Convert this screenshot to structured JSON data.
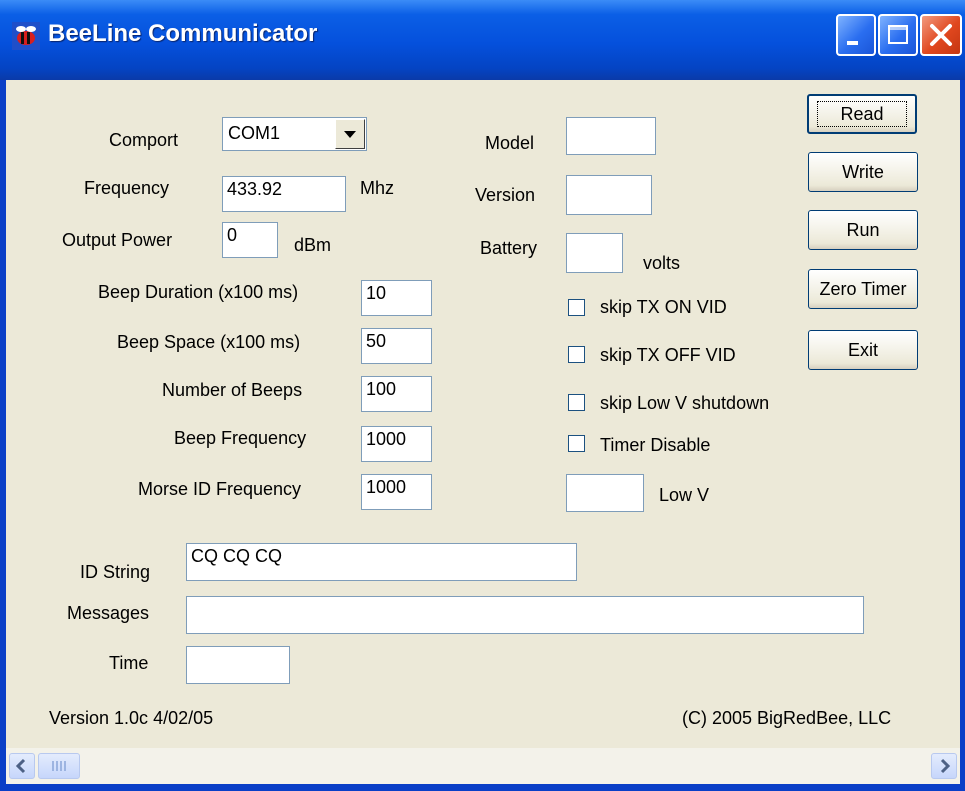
{
  "window": {
    "title": "BeeLine Communicator"
  },
  "left": {
    "comport_label": "Comport",
    "comport_value": "COM1",
    "frequency_label": "Frequency",
    "frequency_value": "433.92",
    "frequency_unit": "Mhz",
    "power_label": "Output Power",
    "power_value": "0",
    "power_unit": "dBm",
    "beep_duration_label": "Beep Duration (x100 ms)",
    "beep_duration_value": "10",
    "beep_space_label": "Beep Space (x100 ms)",
    "beep_space_value": "50",
    "num_beeps_label": "Number of Beeps",
    "num_beeps_value": "100",
    "beep_freq_label": "Beep Frequency",
    "beep_freq_value": "1000",
    "morse_freq_label": "Morse ID Frequency",
    "morse_freq_value": "1000"
  },
  "right": {
    "model_label": "Model",
    "model_value": "",
    "version_label": "Version",
    "version_value": "",
    "battery_label": "Battery",
    "battery_value": "",
    "battery_unit": "volts",
    "checkboxes": [
      {
        "label": "skip TX ON VID",
        "checked": false
      },
      {
        "label": "skip TX OFF VID",
        "checked": false
      },
      {
        "label": "skip Low V shutdown",
        "checked": false
      },
      {
        "label": "Timer Disable",
        "checked": false
      }
    ],
    "lowv_value": "",
    "lowv_label": "Low V"
  },
  "buttons": {
    "read": "Read",
    "write": "Write",
    "run": "Run",
    "zero_timer": "Zero Timer",
    "exit": "Exit"
  },
  "bottom": {
    "id_string_label": "ID String",
    "id_string_value": "CQ CQ CQ",
    "messages_label": "Messages",
    "messages_value": "",
    "time_label": "Time",
    "time_value": "",
    "version_text": "Version 1.0c 4/02/05",
    "copyright_text": "(C) 2005 BigRedBee, LLC"
  },
  "colors": {
    "titlebar": "#0550dc",
    "client": "#ece9d8",
    "close": "#e0471e"
  },
  "icons": [
    "app-bee-icon",
    "minimize-icon",
    "maximize-icon",
    "close-icon",
    "dropdown-arrow-icon",
    "scroll-left-icon",
    "scroll-right-icon"
  ]
}
